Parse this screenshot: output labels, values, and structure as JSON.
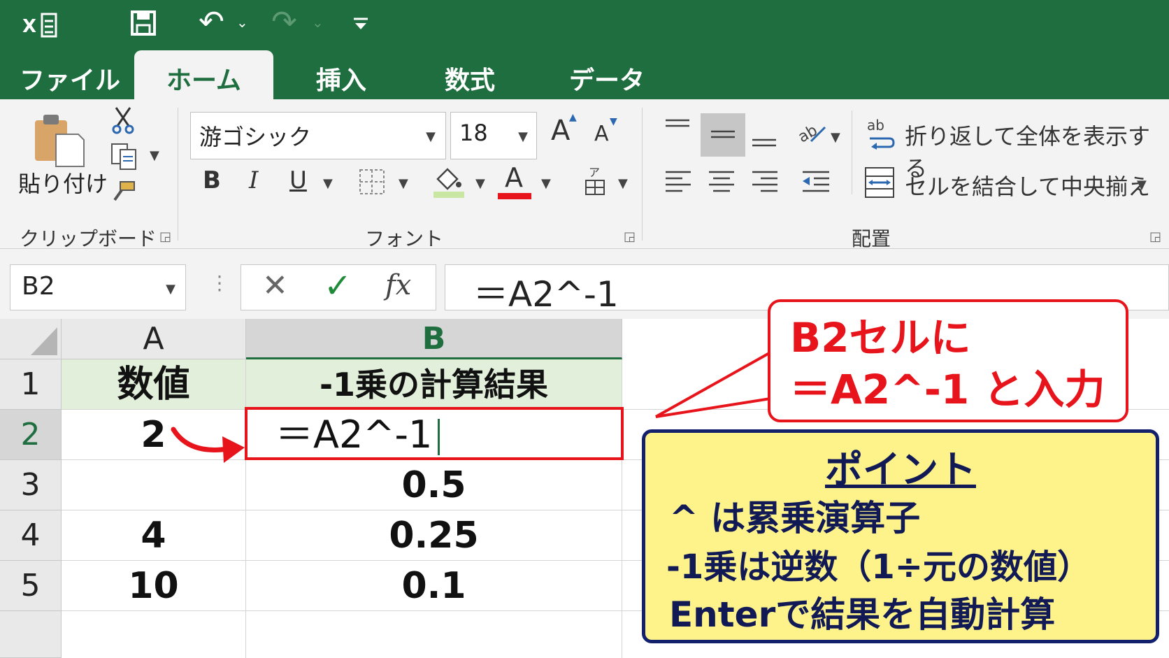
{
  "app": {
    "qat": {
      "undo_label": "↶",
      "redo_label": "↷",
      "more_label": "⌄"
    }
  },
  "tabs": [
    "ファイル",
    "ホーム",
    "挿入",
    "数式",
    "データ"
  ],
  "ribbon": {
    "clipboard": {
      "paste_label": "貼り付け",
      "group_label": "クリップボード"
    },
    "font": {
      "font_name": "游ゴシック",
      "font_size": "18",
      "grow_label": "A",
      "shrink_label": "A",
      "bold_label": "B",
      "italic_label": "I",
      "underline_label": "U",
      "font_color_label": "A",
      "group_label": "フォント"
    },
    "alignment": {
      "wrap_label": "折り返して全体を表示する",
      "merge_label": "セルを結合して中央揃え",
      "group_label": "配置"
    }
  },
  "formula_bar": {
    "name_box": "B2",
    "cancel_label": "✕",
    "enter_label": "✓",
    "fx_label": "fx",
    "formula": "＝A2^-1"
  },
  "grid": {
    "columns": [
      "A",
      "B"
    ],
    "rows": [
      "1",
      "2",
      "3",
      "4",
      "5"
    ],
    "cells": {
      "A1": "数値",
      "B1": "-1乗の計算結果",
      "A2": "2",
      "B2": "＝A2^-1",
      "A3": "",
      "B3": "0.5",
      "A4": "4",
      "B4": "0.25",
      "A5": "10",
      "B5": "0.1"
    }
  },
  "callout": {
    "line1": "B2セルに",
    "line2": "＝A2^-1 と入力"
  },
  "point": {
    "title": "ポイント",
    "line1": "^ は累乗演算子",
    "line2": "-1乗は逆数（1÷元の数値）",
    "line3": "Enterで結果を自動計算"
  },
  "colors": {
    "excel_green": "#1e6e3f",
    "callout_red": "#e8141b",
    "point_bg": "#fdf38a",
    "point_border": "#13206b"
  }
}
